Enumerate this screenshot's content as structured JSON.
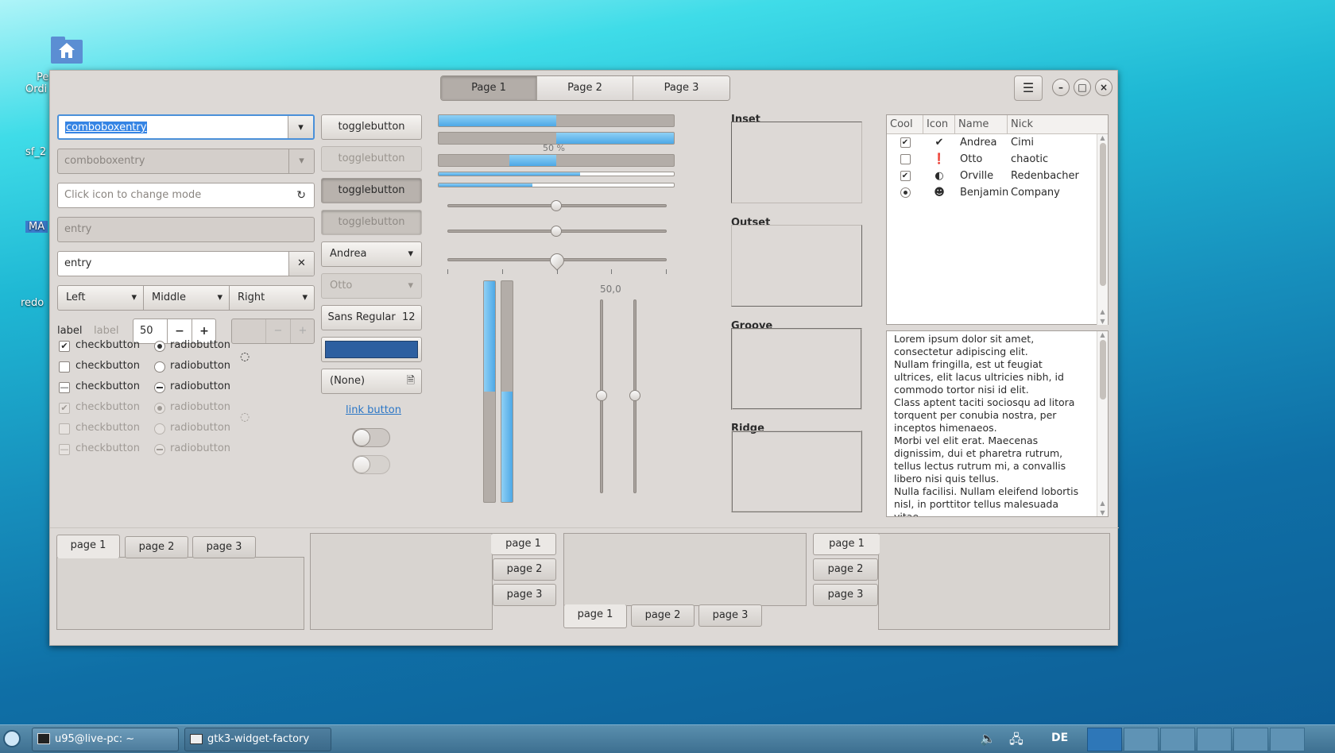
{
  "desktop": {
    "icons": [
      "Pe",
      "Ordi",
      "sf_2",
      "MA",
      "redo"
    ]
  },
  "window": {
    "header_tabs": [
      "Page 1",
      "Page 2",
      "Page 3"
    ],
    "menu_icon": "hamburger-icon",
    "controls": {
      "minimize": "–",
      "maximize": "□",
      "close": "×"
    }
  },
  "col1": {
    "combo1": "comboboxentry",
    "combo2": "comboboxentry",
    "mode_entry_placeholder": "Click icon to change mode",
    "entry_disabled": "entry",
    "entry_clear": "entry",
    "segments": [
      "Left",
      "Middle",
      "Right"
    ],
    "label1": "label",
    "label2": "label",
    "spin_value": "50",
    "spin_minus": "−",
    "spin_plus": "+",
    "checks": [
      {
        "label": "checkbutton",
        "state": "checked",
        "disabled": false
      },
      {
        "label": "checkbutton",
        "state": "unchecked",
        "disabled": false
      },
      {
        "label": "checkbutton",
        "state": "mixed",
        "disabled": false
      },
      {
        "label": "checkbutton",
        "state": "checked",
        "disabled": true
      },
      {
        "label": "checkbutton",
        "state": "unchecked",
        "disabled": true
      },
      {
        "label": "checkbutton",
        "state": "mixed",
        "disabled": true
      }
    ],
    "radios": [
      {
        "label": "radiobutton",
        "state": "checked",
        "disabled": false
      },
      {
        "label": "radiobutton",
        "state": "unchecked",
        "disabled": false
      },
      {
        "label": "radiobutton",
        "state": "mixed",
        "disabled": false
      },
      {
        "label": "radiobutton",
        "state": "checked",
        "disabled": true
      },
      {
        "label": "radiobutton",
        "state": "unchecked",
        "disabled": true
      },
      {
        "label": "radiobutton",
        "state": "mixed",
        "disabled": true
      }
    ]
  },
  "col2": {
    "toggle1": "togglebutton",
    "toggle2": "togglebutton",
    "toggle3": "togglebutton",
    "toggle4": "togglebutton",
    "combo_andrea": "Andrea",
    "combo_otto": "Otto",
    "font_name": "Sans Regular",
    "font_size": "12",
    "color_hex": "#2d5fa0",
    "file_none": "(None)",
    "link": "link button"
  },
  "col3": {
    "progress": [
      0.5,
      0.5,
      0.2,
      0.6,
      0.4
    ],
    "progress_text": "50 %",
    "scale_value": "50,0"
  },
  "frames": [
    "Inset",
    "Outset",
    "Groove",
    "Ridge"
  ],
  "tree": {
    "headers": [
      "Cool",
      "Icon",
      "Name",
      "Nick"
    ],
    "rows": [
      {
        "cool": "checked",
        "icon": "check-circle-icon",
        "name": "Andrea",
        "nick": "Cimi"
      },
      {
        "cool": "unchecked",
        "icon": "exclamation-circle-icon",
        "name": "Otto",
        "nick": "chaotic"
      },
      {
        "cool": "checked",
        "icon": "half-moon-icon",
        "name": "Orville",
        "nick": "Redenbacher"
      },
      {
        "cool": "radio",
        "icon": "face-icon",
        "name": "Benjamin",
        "nick": "Company"
      }
    ]
  },
  "textview": {
    "lines": [
      "Lorem ipsum dolor sit amet,",
      "consectetur adipiscing elit.",
      "Nullam fringilla, est ut feugiat",
      "ultrices, elit lacus ultricies nibh, id",
      "commodo tortor nisi id elit.",
      "Class aptent taciti sociosqu ad litora",
      "torquent per conubia nostra, per",
      "inceptos himenaeos.",
      "Morbi vel elit erat. Maecenas",
      "dignissim, dui et pharetra rutrum,",
      "tellus lectus rutrum mi, a convallis",
      "libero nisi quis tellus.",
      "Nulla facilisi. Nullam eleifend lobortis",
      "nisl, in porttitor tellus malesuada",
      "vitae."
    ]
  },
  "notebooks": {
    "nb1": [
      "page 1",
      "page 2",
      "page 3"
    ],
    "nb2": [
      "page 1",
      "page 2",
      "page 3"
    ],
    "nb3": [
      "page 1",
      "page 2",
      "page 3"
    ],
    "nb4": [
      "page 1",
      "page 2",
      "page 3"
    ]
  },
  "taskbar": {
    "terminal": "u95@live-pc: ~",
    "app": "gtk3-widget-factory",
    "keyboard": "DE"
  }
}
